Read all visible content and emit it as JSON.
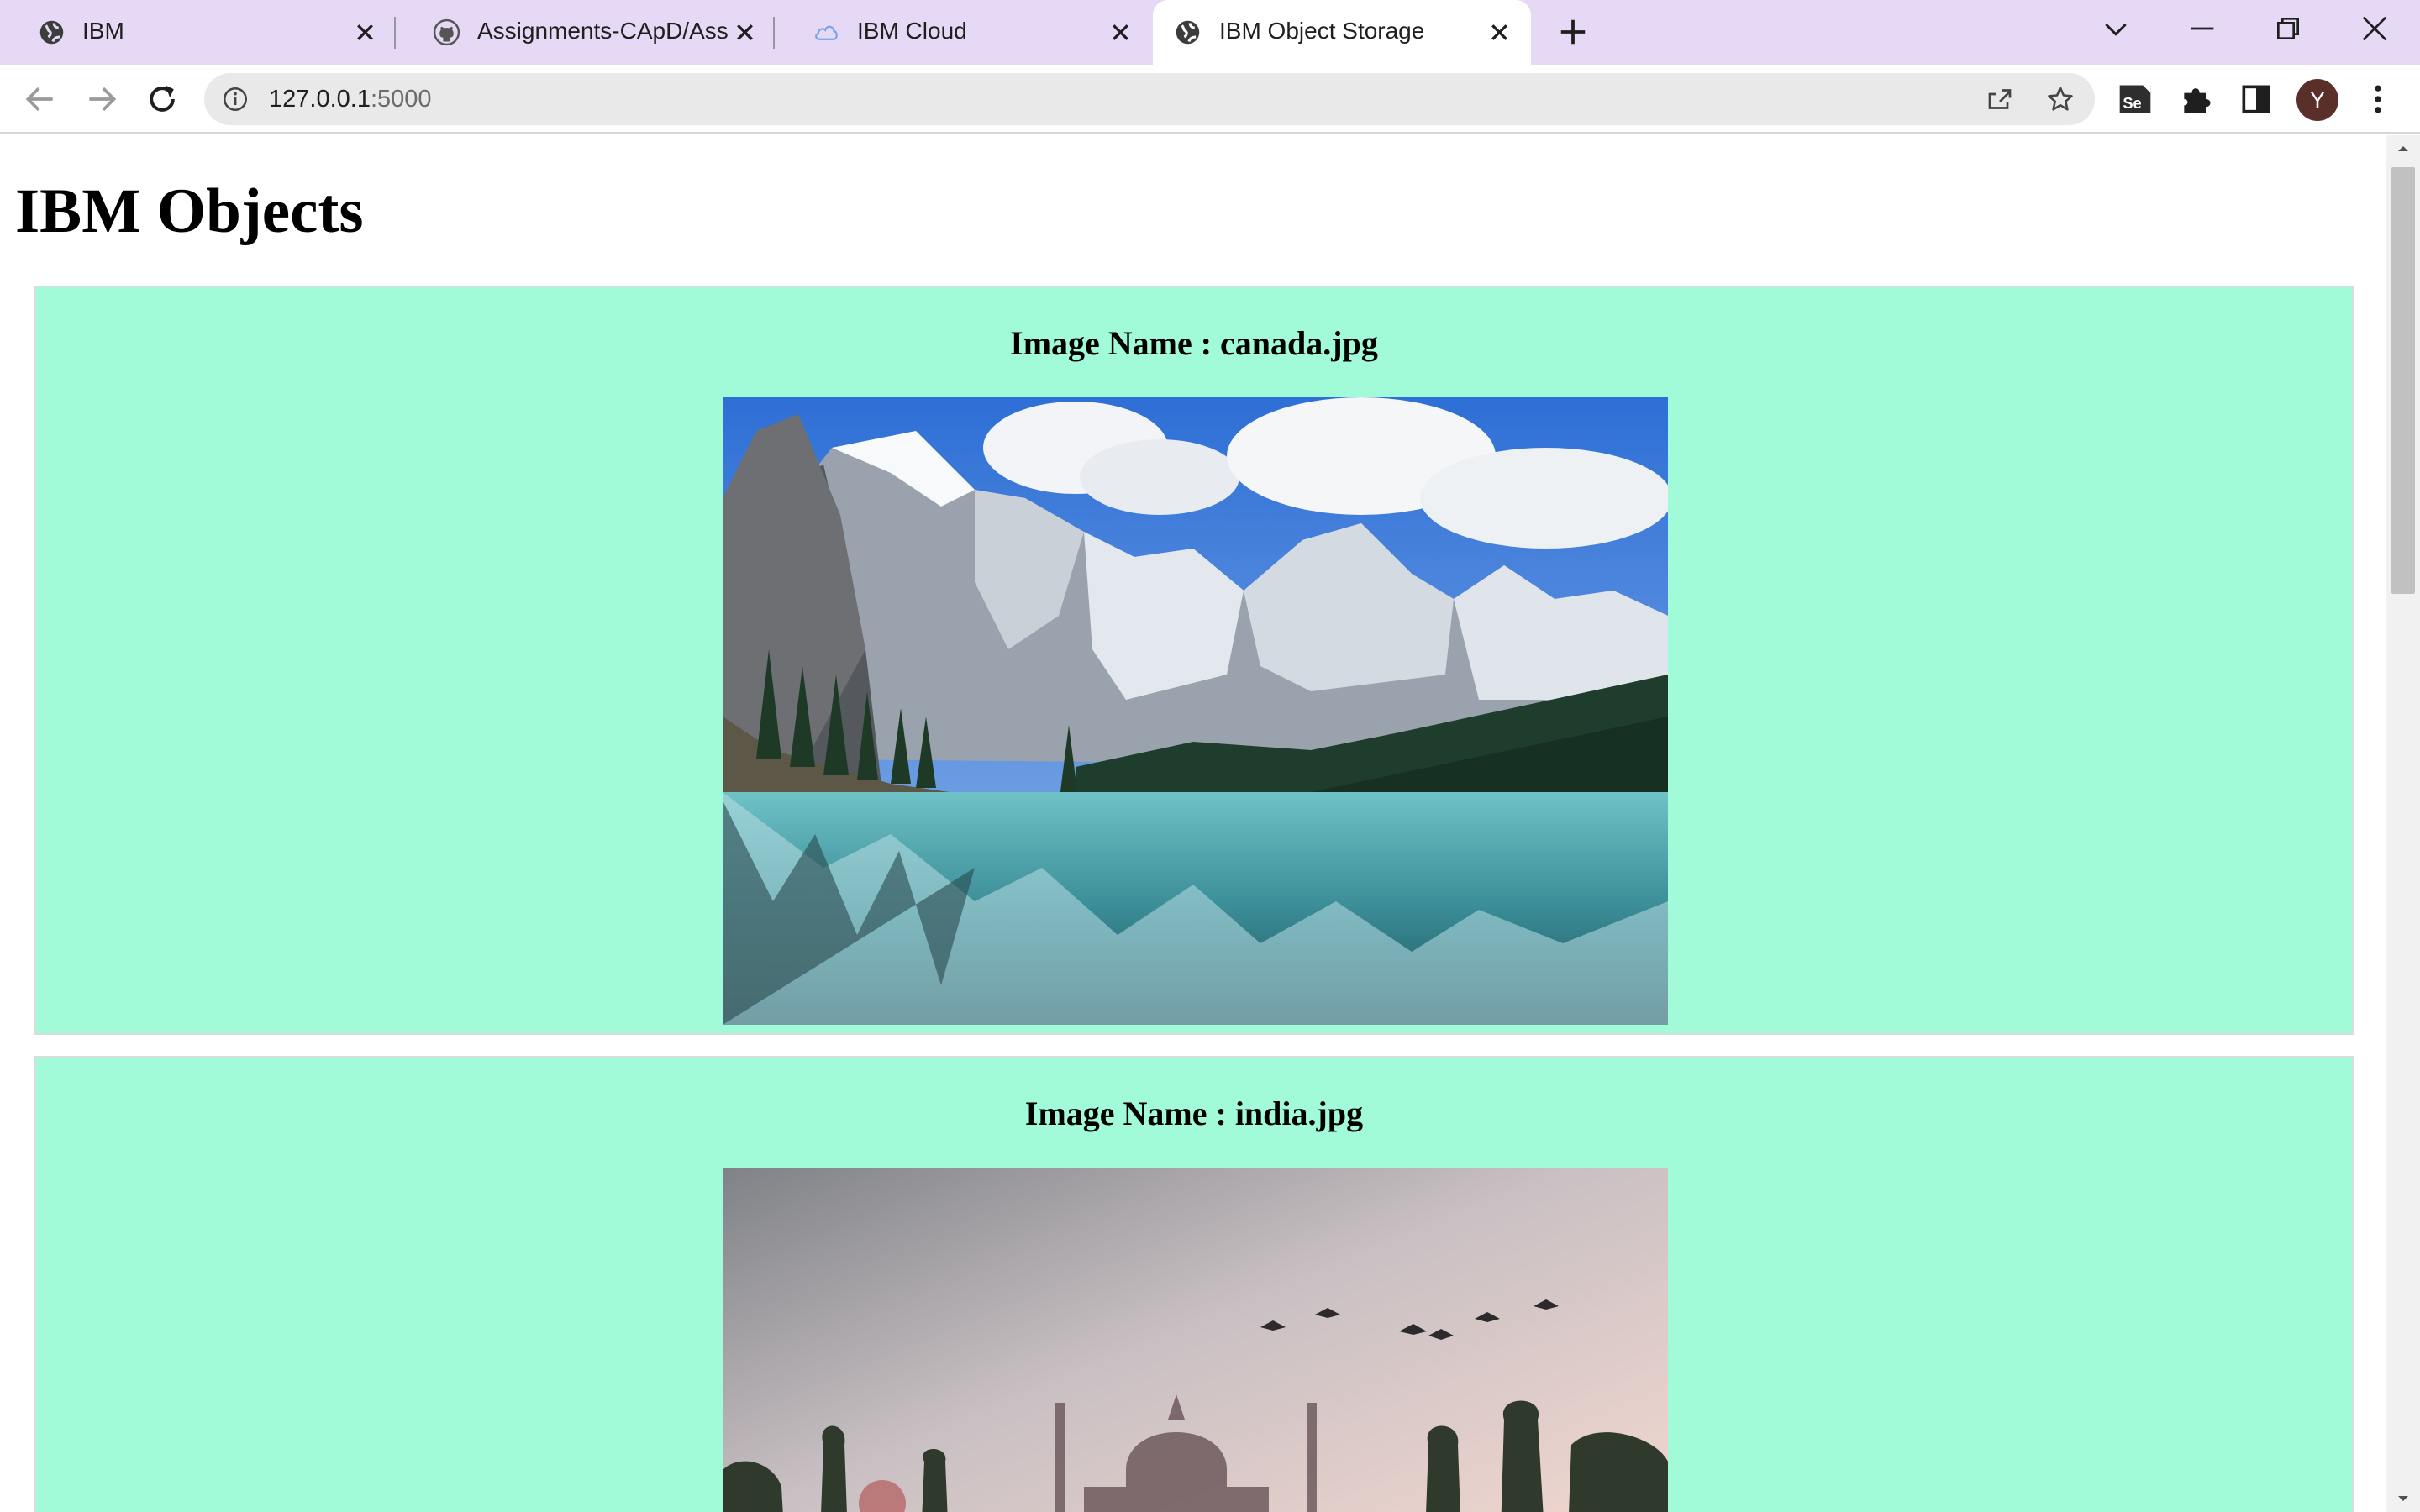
{
  "browser": {
    "tabs": [
      {
        "title": "IBM",
        "icon": "globe-icon",
        "active": false
      },
      {
        "title": "Assignments-CApD/Assig",
        "icon": "github-icon",
        "active": false
      },
      {
        "title": "IBM Cloud",
        "icon": "cloud-icon",
        "active": false
      },
      {
        "title": "IBM Object Storage",
        "icon": "globe-icon",
        "active": true
      }
    ],
    "address": {
      "host": "127.0.0.1",
      "port": ":5000"
    },
    "profile_initial": "Y",
    "toolbar_icons": [
      "back-icon",
      "forward-icon",
      "reload-icon",
      "site-info-icon",
      "share-icon",
      "star-icon",
      "selenium-extension-icon",
      "extensions-puzzle-icon",
      "side-panel-icon",
      "more-menu-icon"
    ],
    "window_controls": [
      "tab-search-icon",
      "minimize-icon",
      "restore-icon",
      "close-window-icon"
    ]
  },
  "page": {
    "heading": "IBM Objects",
    "items": [
      {
        "label": "Image Name : ",
        "file": "canada.jpg",
        "image_subject": "mountain lake landscape"
      },
      {
        "label": "Image Name : ",
        "file": "india.jpg",
        "image_subject": "taj mahal at dusk with birds"
      }
    ]
  },
  "colors": {
    "tab_strip": "#e5d9f5",
    "card_background": "#a2fbd8",
    "omnibox": "#e9e9ea",
    "avatar": "#5a2f2a"
  }
}
